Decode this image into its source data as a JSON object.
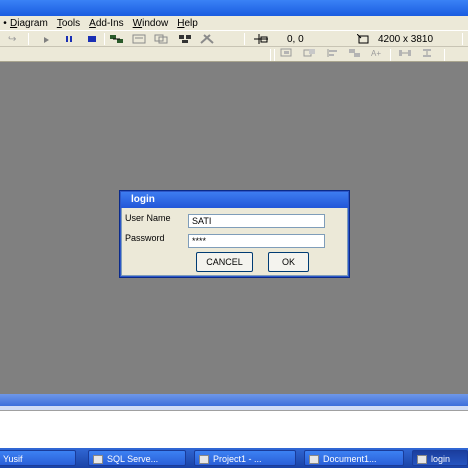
{
  "menubar": {
    "lead": "•",
    "items": [
      {
        "u": "D",
        "rest": "iagram"
      },
      {
        "u": "T",
        "rest": "ools"
      },
      {
        "u": "A",
        "rest": "dd-Ins"
      },
      {
        "u": "W",
        "rest": "indow"
      },
      {
        "u": "H",
        "rest": "elp"
      }
    ]
  },
  "toolbar": {
    "coords": "0, 0",
    "size": "4200 x 3810"
  },
  "dialog": {
    "title": "login",
    "username_label": "User Name",
    "username_value": "SATI",
    "password_label": "Password",
    "password_value": "****",
    "cancel_label": "CANCEL",
    "ok_label": "OK"
  },
  "taskbar": {
    "items": [
      {
        "label": "Yusif"
      },
      {
        "label": "SQL Serve..."
      },
      {
        "label": "Project1 - ..."
      },
      {
        "label": "Document1..."
      },
      {
        "label": "login"
      }
    ]
  }
}
